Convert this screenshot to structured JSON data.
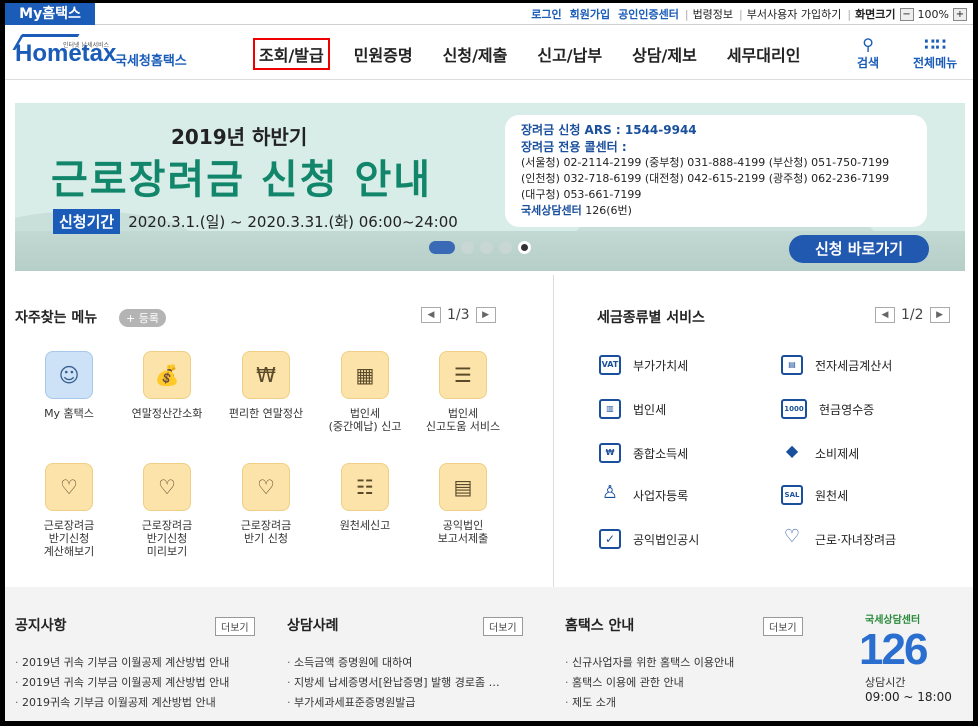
{
  "top": {
    "my_hometax": "My홈택스",
    "links": [
      "로그인",
      "회원가입",
      "공인인증센터",
      "법령정보",
      "부서사용자 가입하기",
      "화면크기"
    ],
    "zoom": "100%",
    "zoom_minus": "−",
    "zoom_plus": "+"
  },
  "logo": {
    "tiny": "인터넷 납세서비스",
    "mark": "Hometax",
    "kr": "국세청홈택스"
  },
  "nav": [
    "조회/발급",
    "민원증명",
    "신청/제출",
    "신고/납부",
    "상담/제보",
    "세무대리인"
  ],
  "nav_selected": 0,
  "header_buttons": {
    "search": "검색",
    "all_menu": "전체메뉴"
  },
  "banner": {
    "subtitle": "2019년 하반기",
    "title": "근로장려금 신청 안내",
    "period_tag": "신청기간",
    "period": "2020.3.1.(일) ~ 2020.3.31.(화) 06:00~24:00",
    "ars": "장려금 신청 ARS : 1544-9944",
    "callcenter": "장려금 전용 콜센터 :",
    "lines": [
      "(서울청) 02-2114-2199 (중부청) 031-888-4199 (부산청) 051-750-7199",
      "(인천청) 032-718-6199 (대전청) 042-615-2199 (광주청) 062-236-7199",
      "(대구청) 053-661-7199"
    ],
    "counsel_label": "국세상담센터",
    "counsel_num": "126(6번)",
    "go": "신청 바로가기"
  },
  "freq": {
    "title": "자주찾는 메뉴",
    "register": "+ 등록",
    "page": "1/3",
    "items": [
      {
        "label": "My 홈택스",
        "icon": "person-icon"
      },
      {
        "label": "연말정산간소화",
        "icon": "tax-bag-icon"
      },
      {
        "label": "편리한 연말정산",
        "icon": "won-calc-icon"
      },
      {
        "label": "법인세\n(중간예납) 신고",
        "icon": "building-icon"
      },
      {
        "label": "법인세\n신고도움 서비스",
        "icon": "document-search-icon"
      },
      {
        "label": "근로장려금\n반기신청\n계산해보기",
        "icon": "heart-calc-icon"
      },
      {
        "label": "근로장려금\n반기신청\n미리보기",
        "icon": "heart-search-icon"
      },
      {
        "label": "근로장려금\n반기 신청",
        "icon": "heart-hand-icon"
      },
      {
        "label": "원천세신고",
        "icon": "calendar-icon"
      },
      {
        "label": "공익법인\n보고서제출",
        "icon": "report-icon"
      }
    ]
  },
  "svc": {
    "title": "세금종류별 서비스",
    "page": "1/2",
    "items": [
      {
        "label": "부가가치세",
        "icon": "vat-icon",
        "glyph": "VAT"
      },
      {
        "label": "전자세금계산서",
        "icon": "invoice-icon",
        "glyph": "▤"
      },
      {
        "label": "법인세",
        "icon": "building-icon",
        "glyph": "▥"
      },
      {
        "label": "현금영수증",
        "icon": "receipt-icon",
        "glyph": "1000"
      },
      {
        "label": "종합소득세",
        "icon": "money-bag-icon",
        "glyph": "₩"
      },
      {
        "label": "소비제세",
        "icon": "diamond-icon",
        "glyph": "◆"
      },
      {
        "label": "사업자등록",
        "icon": "person-icon",
        "glyph": "♙"
      },
      {
        "label": "원천세",
        "icon": "salary-icon",
        "glyph": "SAL"
      },
      {
        "label": "공익법인공시",
        "icon": "clipboard-icon",
        "glyph": "✓"
      },
      {
        "label": "근로·자녀장려금",
        "icon": "heart-icon",
        "glyph": "♡"
      }
    ]
  },
  "notice": {
    "title": "공지사항",
    "more": "더보기",
    "items": [
      "2019년 귀속 기부금 이월공제 계산방법 안내",
      "2019년 귀속 기부금 이월공제 계산방법 안내",
      "2019귀속 기부금 이월공제 계산방법 안내"
    ]
  },
  "cases": {
    "title": "상담사례",
    "more": "더보기",
    "items": [
      "소득금액 증명원에 대하여",
      "지방세 납세증명서[완납증명] 발행 경로좀 …",
      "부가세과세표준증명원발급"
    ]
  },
  "guide": {
    "title": "홈택스 안내",
    "more": "더보기",
    "items": [
      "신규사업자를 위한 홈택스 이용안내",
      "홈택스 이용에 관한 안내",
      "제도 소개"
    ]
  },
  "center": {
    "title": "국세상담센터",
    "num": "126",
    "hours_label": "상담시간",
    "hours": "09:00 ~ 18:00"
  },
  "colors": {
    "brand": "#1a5cb8",
    "banner_title": "#12866a",
    "nav_highlight": "#e00000"
  }
}
